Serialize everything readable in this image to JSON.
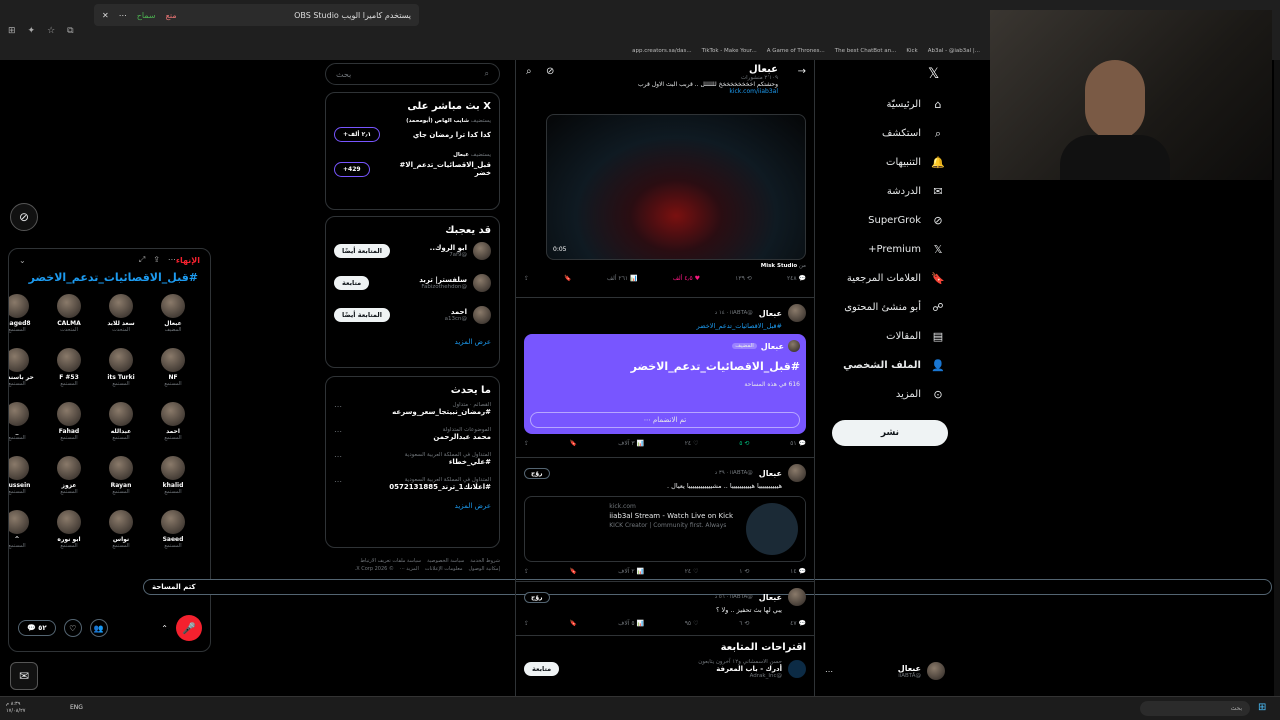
{
  "browser": {
    "obs_notice": "OBS Studio يستخدم كاميرا الويب",
    "obs_block": "منع",
    "obs_allow": "سماح",
    "bookmarks": [
      "app.creators.sa/das...",
      "TikTok - Make Your...",
      "A Game of Thrones...",
      "The best ChatBot an...",
      "Kick",
      "Ab3al - @iab3al |..."
    ]
  },
  "space": {
    "end_label": "الإنهاء",
    "title": "#قبل_الاقصائيات_تدعم_الاخضر",
    "participants": [
      {
        "name": "عبعال",
        "role": "المضيف"
      },
      {
        "name": "سعد للابد",
        "role": "المتحدث"
      },
      {
        "name": "CALMA",
        "role": "المتحدث"
      },
      {
        "name": "maged8",
        "role": "المستمع"
      },
      {
        "name": "NF",
        "role": "المستمع"
      },
      {
        "name": "its Turki",
        "role": "المستمع"
      },
      {
        "name": "F #53",
        "role": "المستمع"
      },
      {
        "name": "حر باسندوة",
        "role": "المستمع"
      },
      {
        "name": "احمد",
        "role": "المستمع"
      },
      {
        "name": "عبدالله",
        "role": "المستمع"
      },
      {
        "name": "Fahad",
        "role": "المستمع"
      },
      {
        "name": "_",
        "role": "المستمع"
      },
      {
        "name": "khalid",
        "role": "المستمع"
      },
      {
        "name": "Rayan",
        "role": "المستمع"
      },
      {
        "name": "عزوز",
        "role": "المستمع"
      },
      {
        "name": "Hussein",
        "role": "المستمع"
      },
      {
        "name": "Saeed",
        "role": "المستمع"
      },
      {
        "name": "نواس",
        "role": "المستمع"
      },
      {
        "name": "ابو نوره",
        "role": "المستمع"
      },
      {
        "name": "^",
        "role": "المستمع"
      }
    ],
    "mute_label": "كتم المساحة",
    "comments_count": "٥٢"
  },
  "search": {
    "placeholder": "بحث"
  },
  "live": {
    "title": "X بث مباشر على",
    "items": [
      {
        "host": "شايب الهاص (أبومحمد)",
        "prefix": "يستضيف",
        "text": "كدا كدا ترا رمضان جاي",
        "count": "٢٫١ ألف+"
      },
      {
        "host": "عبعال",
        "prefix": "يستضيف",
        "text": "قبل_الاقصائيات_تدعم_الا# خضر",
        "count": "429+"
      }
    ]
  },
  "who": {
    "title": "قد يعجبك",
    "users": [
      {
        "name": "ابو الروك..",
        "handle": "@7af9",
        "btn": "المتابعة أيضًا"
      },
      {
        "name": "سلفستر| تربد",
        "handle": "@Fabizothehdon",
        "btn": "متابعة"
      },
      {
        "name": "احمد",
        "handle": "@a13cn",
        "btn": "المتابعة أيضًا"
      }
    ],
    "more": "عرض المزيد"
  },
  "trends": {
    "title": "ما يحدث",
    "items": [
      {
        "meta": "القصائم · متداول",
        "tag": "#رمضان_نبيتجا_سعر_وسرعه"
      },
      {
        "meta": "الموضوعات المتداولة",
        "tag": "محمد عبدالرحمن"
      },
      {
        "meta": "المتداول في المملكة العربية السعودية",
        "tag": "#علي_خطاء"
      },
      {
        "meta": "المتداول في المملكة العربية السعودية",
        "tag": "#اعلانك1_ترند_0572131885"
      }
    ],
    "more": "عرض المزيد"
  },
  "footer_links": [
    "شروط الخدمة",
    "سياسة الخصوصية",
    "سياسة ملفات تعريف الارتباط",
    "إمكانية الوصول",
    "معلومات الإعلانات",
    "المزيد ···",
    "© 2026 X Corp."
  ],
  "feed": {
    "profile_name": "عبعال",
    "profile_posts": "٢٬١٠٩ منشورات",
    "top_text": "وحشتكم اخخخخخخخخخ للللللل .. قربب البث الاول قرب",
    "top_link": "kick.com/iiab3al",
    "video_time": "0:05",
    "video_source": "Misk Studio",
    "t1_stats": [
      "٢٤٨",
      "٤٫٥ ألف",
      "١٣٩",
      "٢٦١ ألف"
    ],
    "t2_name": "عبعال",
    "t2_handle": "@iiABTA · ١٤ د",
    "t2_tag": "#قبل_الاقصائيات_تدعم_الاخضر",
    "space_card_host": "عبعال",
    "space_card_badge": "المضيف",
    "space_card_title": "#قبل_الاقصائيات_تدعم_الاخضر",
    "space_card_count": "616 في هذه المساحة",
    "space_card_btn": "تم الانضمام",
    "t2_stats": [
      "٥١",
      "٥",
      "٢٤",
      "٣ آلاف"
    ],
    "t3_name": "عبعال",
    "t3_handle": "@iiABTA · ٣٩ د",
    "t3_badge": "روّج",
    "t3_text": "هييييييييييا هييييييييييا .. مشييييييييييييا يعيال .",
    "link_domain": "kick.com",
    "link_title": "iiab3al Stream - Watch Live on Kick",
    "link_desc": "KICK Creator | Community first. Always",
    "t3_stats": [
      "١٤",
      "١",
      "٢٤",
      "٢ آلاف"
    ],
    "t4_name": "عبعال",
    "t4_handle": "@iiABTA · ٥٦ د",
    "t4_badge": "روّج",
    "t4_text": "يبي لها بث تحفيز .. ولا ؟",
    "t4_stats": [
      "٤٧",
      "٦",
      "٩٥",
      "٥ آلاف"
    ],
    "suggest_title": "اقتراحات المتابعة",
    "suggest_meta": "حسن الاسمشاني و١٢ آخرون يتابعون",
    "suggest_name": "أدرك - باب المعرفة",
    "suggest_handle": "@Adrak_Inc",
    "suggest_btn": "متابعة"
  },
  "nav": {
    "items": [
      "الرئيسيّة",
      "استكشف",
      "التنبيهات",
      "الدردشة",
      "SuperGrok",
      "Premium+",
      "العلامات المرجعية",
      "أبو منشئ المحتوى",
      "المقالات",
      "الملف الشخصي",
      "المزيد"
    ],
    "post": "نشر",
    "account_name": "عبعال",
    "account_handle": "@iiABTA",
    "notif_count": "1"
  },
  "taskbar": {
    "lang": "ENG",
    "time": "٨:٣٩ م",
    "date": "١٧/٠٨/٢٧",
    "search": "بحث"
  }
}
